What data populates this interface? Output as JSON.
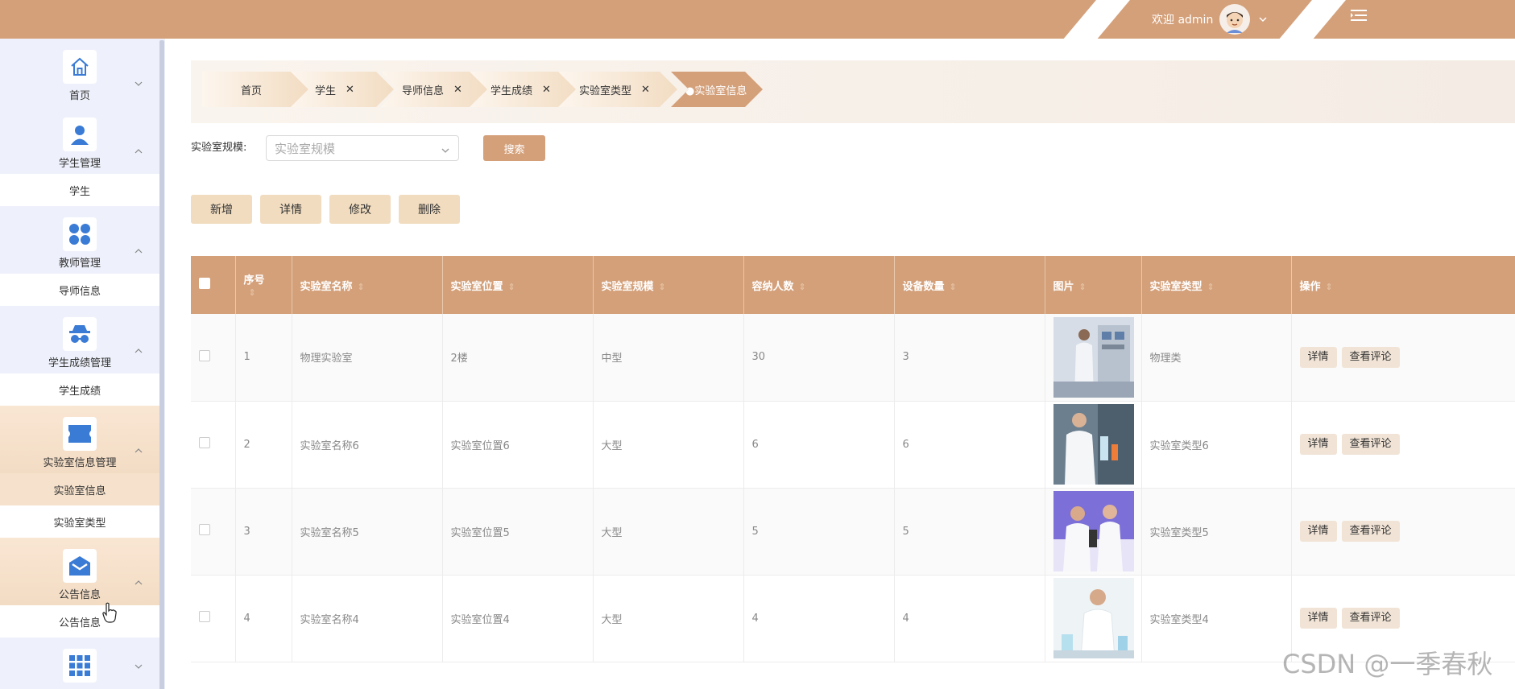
{
  "header": {
    "welcome": "欢迎 admin"
  },
  "sidebar": {
    "groups": [
      {
        "label": "首页",
        "icon": "home-icon",
        "subs": []
      },
      {
        "label": "学生管理",
        "icon": "user-icon",
        "subs": [
          "学生"
        ]
      },
      {
        "label": "教师管理",
        "icon": "grid-dots-icon",
        "subs": [
          "导师信息"
        ]
      },
      {
        "label": "学生成绩管理",
        "icon": "spy-icon",
        "subs": [
          "学生成绩"
        ]
      },
      {
        "label": "实验室信息管理",
        "icon": "ticket-icon",
        "subs": [
          "实验室信息",
          "实验室类型"
        ]
      },
      {
        "label": "公告信息",
        "icon": "mail-icon",
        "subs": [
          "公告信息"
        ]
      }
    ]
  },
  "tabs": [
    {
      "label": "首页",
      "closable": false,
      "active": false
    },
    {
      "label": "学生",
      "closable": true,
      "active": false
    },
    {
      "label": "导师信息",
      "closable": true,
      "active": false
    },
    {
      "label": "学生成绩",
      "closable": true,
      "active": false
    },
    {
      "label": "实验室类型",
      "closable": true,
      "active": false
    },
    {
      "label": "●实验室信息",
      "closable": false,
      "active": true
    }
  ],
  "search": {
    "label": "实验室规模:",
    "placeholder": "实验室规模",
    "button": "搜索"
  },
  "actions": {
    "add": "新增",
    "detail": "详情",
    "edit": "修改",
    "delete": "删除"
  },
  "table": {
    "headers": [
      "序号",
      "实验室名称",
      "实验室位置",
      "实验室规模",
      "容纳人数",
      "设备数量",
      "图片",
      "实验室类型",
      "操作"
    ],
    "rows": [
      {
        "index": "1",
        "name": "物理实验室",
        "location": "2楼",
        "scale": "中型",
        "capacity": "30",
        "devices": "3",
        "type": "物理类"
      },
      {
        "index": "2",
        "name": "实验室名称6",
        "location": "实验室位置6",
        "scale": "大型",
        "capacity": "6",
        "devices": "6",
        "type": "实验室类型6"
      },
      {
        "index": "3",
        "name": "实验室名称5",
        "location": "实验室位置5",
        "scale": "大型",
        "capacity": "5",
        "devices": "5",
        "type": "实验室类型5"
      },
      {
        "index": "4",
        "name": "实验室名称4",
        "location": "实验室位置4",
        "scale": "大型",
        "capacity": "4",
        "devices": "4",
        "type": "实验室类型4"
      }
    ],
    "op_detail": "详情",
    "op_comment": "查看评论"
  },
  "watermark": "CSDN @一季春秋",
  "colors": {
    "primary": "#d4a07a",
    "button_light": "#f1dcbf",
    "sidebar_bg": "#eef1fb",
    "icon_blue": "#3a7bd5"
  }
}
